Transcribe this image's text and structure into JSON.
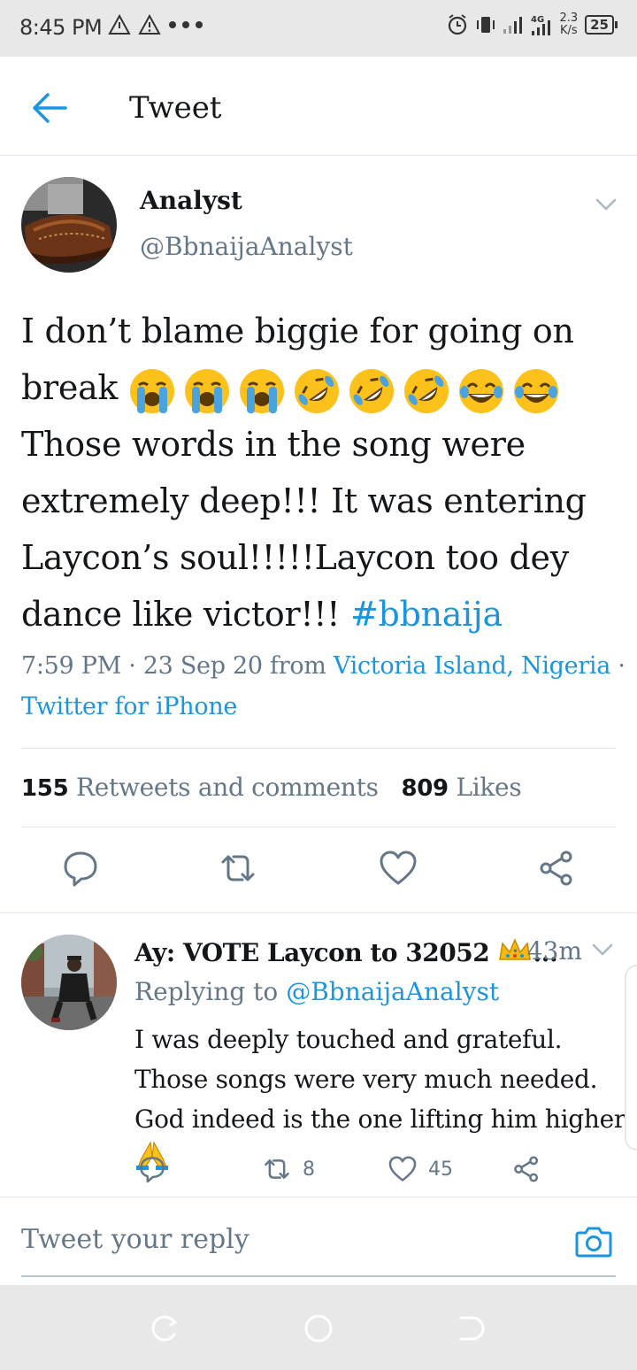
{
  "status_bar": {
    "time": "8:45 PM",
    "network": "4G",
    "speed_value": "2.3",
    "speed_unit": "K/s",
    "battery": "25"
  },
  "header": {
    "title": "Tweet"
  },
  "tweet": {
    "author_name": "Analyst",
    "author_handle": "@BbnaijaAnalyst",
    "text_part1": "I don’t blame biggie for going on break ",
    "text_part2": "Those words in the song were extremely deep!!! It was entering Laycon’s soul!!!!!Laycon too dey dance like victor!!!  ",
    "hashtag": "#bbnaija",
    "time": "7:59 PM",
    "date": "23 Sep 20",
    "from_label": "from",
    "location": "Victoria Island, Nigeria",
    "client": "Twitter for iPhone",
    "retweets_count": "155",
    "retweets_label": "Retweets and comments",
    "likes_count": "809",
    "likes_label": "Likes"
  },
  "reply": {
    "author_name": "Ay: VOTE Laycon to 32052",
    "ellipsis": "...",
    "time": "· 43m",
    "replying_to_label": "Replying to",
    "replying_to_handle": "@BbnaijaAnalyst",
    "text": "I was deeply touched and grateful. Those songs were very much needed. God indeed is the one lifting him higher ",
    "retweets": "8",
    "likes": "45"
  },
  "compose": {
    "placeholder": "Tweet your reply"
  },
  "colors": {
    "accent": "#1b95e0",
    "muted": "#657786",
    "text": "#14171a",
    "divider": "#e1e8ed"
  }
}
